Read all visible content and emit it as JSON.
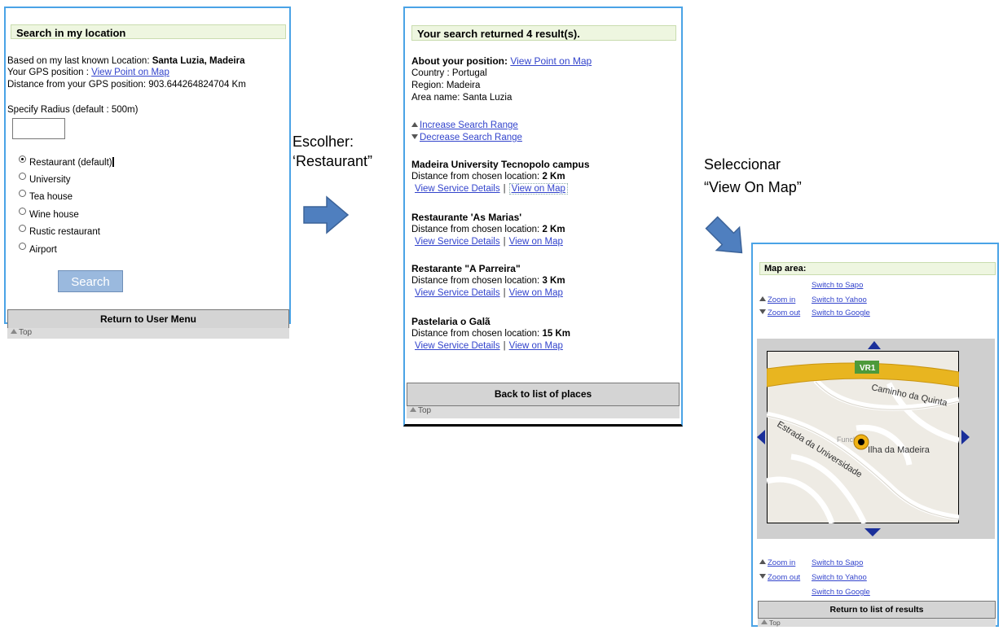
{
  "screen1": {
    "header": "Search in my location",
    "location_prefix": "Based on my last known Location:",
    "location_value": "Santa Luzia, Madeira",
    "gps_prefix": "Your GPS position :",
    "gps_link": "View Point on Map",
    "distance": "Distance from your GPS position: 903.644264824704 Km",
    "radius_label": "Specify Radius (default : 500m)",
    "radius_value": "",
    "options": [
      "Restaurant (default)",
      "University",
      "Tea house",
      "Wine house",
      "Rustic restaurant",
      "Airport"
    ],
    "selected_option": "Restaurant (default)",
    "search_button": "Search",
    "return_button": "Return to User Menu",
    "top_link": "Top"
  },
  "caption1": {
    "line1": "Escolher:",
    "line2": "‘Restaurant”"
  },
  "screen2": {
    "header": "Your search returned 4 result(s).",
    "about_label": "About your position:",
    "about_link": "View Point on Map",
    "country": "Country : Portugal",
    "region": "Region: Madeira",
    "area": "Area name: Santa Luzia",
    "increase": "Increase Search Range",
    "decrease": "Decrease Search Range",
    "results": [
      {
        "name": "Madeira University Tecnopolo campus",
        "distance_label": "Distance from chosen location:",
        "distance_value": "2 Km",
        "details": "View Service Details",
        "map": "View on Map"
      },
      {
        "name": "Restaurante 'As Marias'",
        "distance_label": "Distance from chosen location:",
        "distance_value": "2 Km",
        "details": "View Service Details",
        "map": "View on Map"
      },
      {
        "name": "Restarante \"A Parreira\"",
        "distance_label": "Distance from chosen location:",
        "distance_value": "3 Km",
        "details": "View Service Details",
        "map": "View on Map"
      },
      {
        "name": "Pastelaria o Galã",
        "distance_label": "Distance from chosen location:",
        "distance_value": "15 Km",
        "details": "View Service Details",
        "map": "View on Map"
      }
    ],
    "separator": "|",
    "back_button": "Back to list of places",
    "top_link": "Top"
  },
  "caption2": {
    "line1": "Seleccionar",
    "line2": "“View On Map”"
  },
  "screen3": {
    "header": "Map area:",
    "switch_sapo": "Switch to Sapo",
    "switch_yahoo": "Switch to Yahoo",
    "switch_google": "Switch to Google",
    "zoom_in": "Zoom in",
    "zoom_out": "Zoom out",
    "map_labels": {
      "road_badge": "VR1",
      "street1": "Caminho da Quinta",
      "street2": "Estrada da Universidade",
      "place": "Ilha da Madeira",
      "poi": "Funch"
    },
    "return_button": "Return to list of results",
    "top_link": "Top"
  },
  "colors": {
    "frame": "#4aa3e6",
    "header_bg": "#eef6e0",
    "link": "#3344cc",
    "arrow": "#4f7fbf",
    "nav_triangle": "#1a2f9a",
    "road": "#e8b520"
  }
}
